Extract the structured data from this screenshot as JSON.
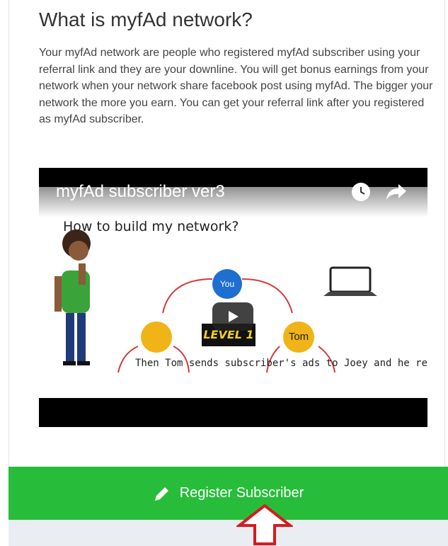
{
  "section": {
    "title": "What is myfAd network?",
    "description": "Your myfAd network are people who registered myfAd subscriber using your referral link and they are your downline. You will get bonus earnings from your network when your network share facebook post using myfAd. The bigger your network the more you earn. You can get your referral link after you registered as myfAd subscriber."
  },
  "video": {
    "title": "myfAd subscriber ver3",
    "subtitle": "How to build my network?",
    "node_you": "You",
    "node_tom": "Tom",
    "level_badge": "LEVEL 1",
    "caption": "Then Tom sends subscriber's ads to Joey and he registers",
    "icons": [
      "clock-icon",
      "share-arrow-icon",
      "play-icon",
      "laptop-icon"
    ]
  },
  "register": {
    "label": "Register Subscriber",
    "icon": "pencil-icon",
    "color": "#27bd3a"
  },
  "annotation": {
    "icon": "red-up-arrow-icon",
    "color": "#d71920"
  }
}
